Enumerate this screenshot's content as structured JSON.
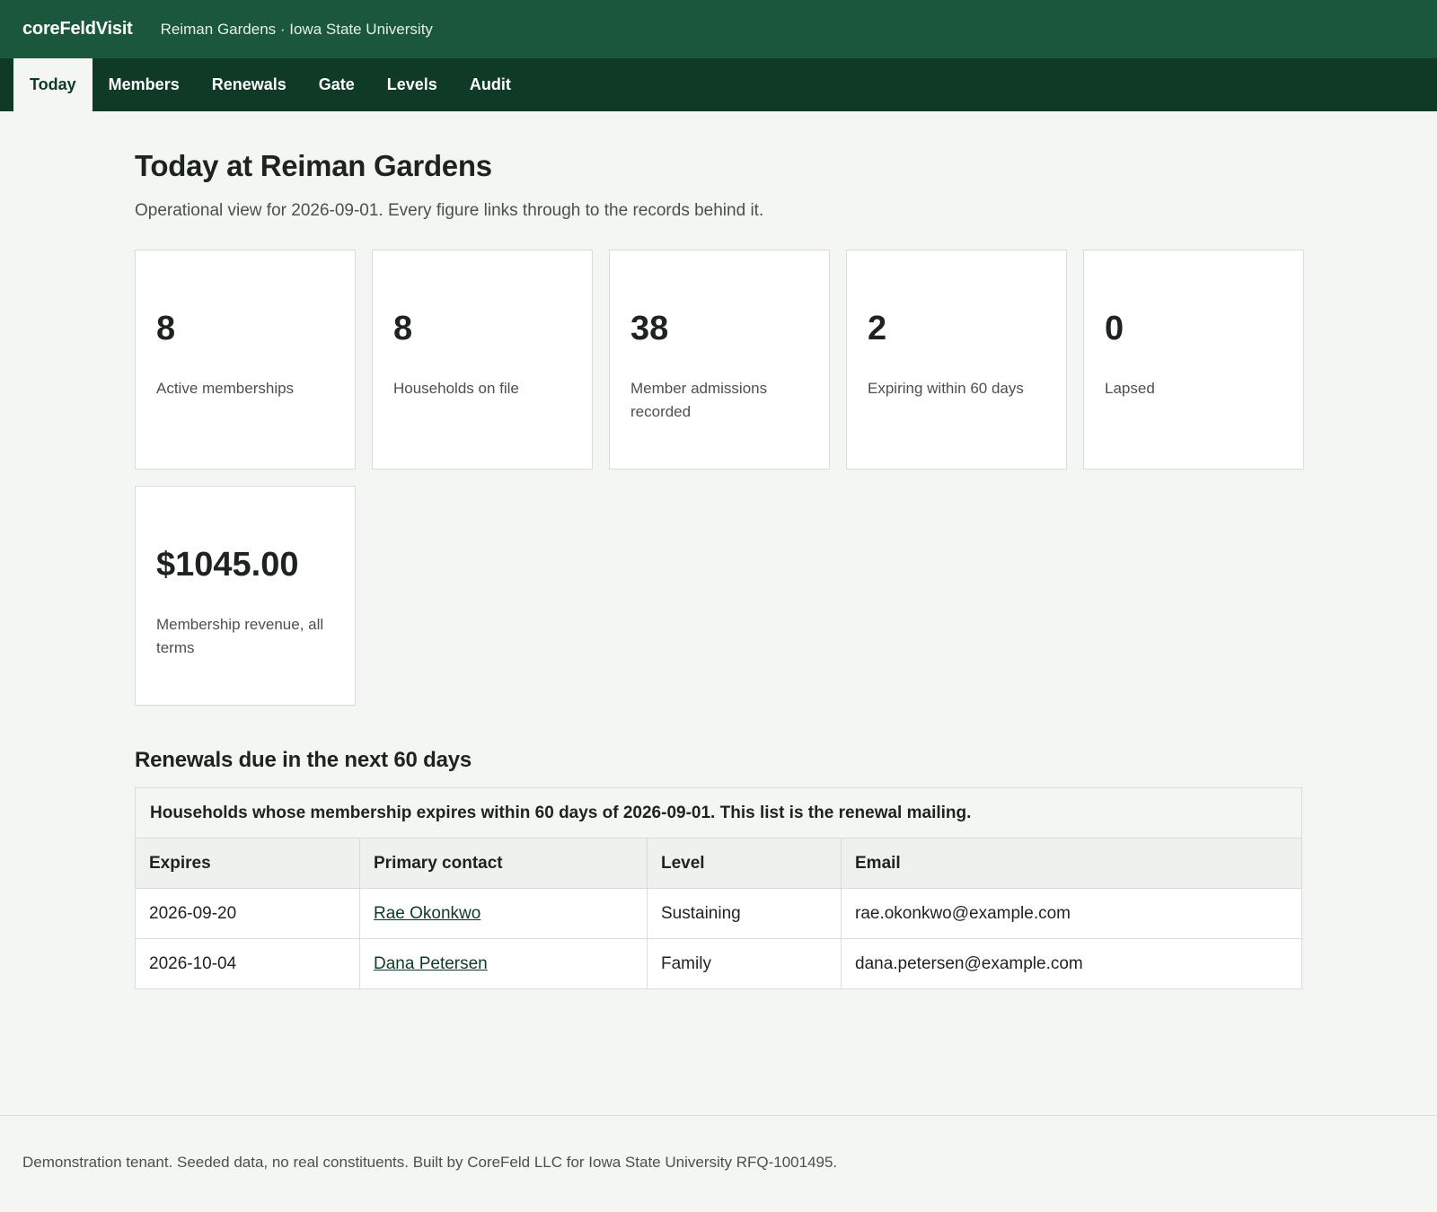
{
  "header": {
    "brand": "coreFeldVisit",
    "org": "Reiman Gardens · Iowa State University"
  },
  "nav": {
    "tabs": [
      {
        "label": "Today",
        "active": true
      },
      {
        "label": "Members"
      },
      {
        "label": "Renewals"
      },
      {
        "label": "Gate"
      },
      {
        "label": "Levels"
      },
      {
        "label": "Audit"
      }
    ]
  },
  "main": {
    "title": "Today at Reiman Gardens",
    "subtitle": "Operational view for 2026-09-01. Every figure links through to the records behind it.",
    "stats": [
      {
        "value": "8",
        "label": "Active memberships"
      },
      {
        "value": "8",
        "label": "Households on file"
      },
      {
        "value": "38",
        "label": "Member admissions recorded"
      },
      {
        "value": "2",
        "label": "Expiring within 60 days"
      },
      {
        "value": "0",
        "label": "Lapsed"
      },
      {
        "value": "$1045.00",
        "label": "Membership revenue, all terms"
      }
    ],
    "renewals": {
      "title": "Renewals due in the next 60 days",
      "caption": "Households whose membership expires within 60 days of 2026-09-01. This list is the renewal mailing.",
      "columns": [
        "Expires",
        "Primary contact",
        "Level",
        "Email"
      ],
      "rows": [
        {
          "expires": "2026-09-20",
          "contact": "Rae Okonkwo",
          "level": "Sustaining",
          "email": "rae.okonkwo@example.com"
        },
        {
          "expires": "2026-10-04",
          "contact": "Dana Petersen",
          "level": "Family",
          "email": "dana.petersen@example.com"
        }
      ]
    }
  },
  "footer": {
    "text": "Demonstration tenant. Seeded data, no real constituents. Built by CoreFeld LLC for Iowa State University RFQ-1001495."
  },
  "colors": {
    "header_bg": "#1a573c",
    "nav_bg": "#0f3a25",
    "page_bg": "#f4f6f3"
  }
}
